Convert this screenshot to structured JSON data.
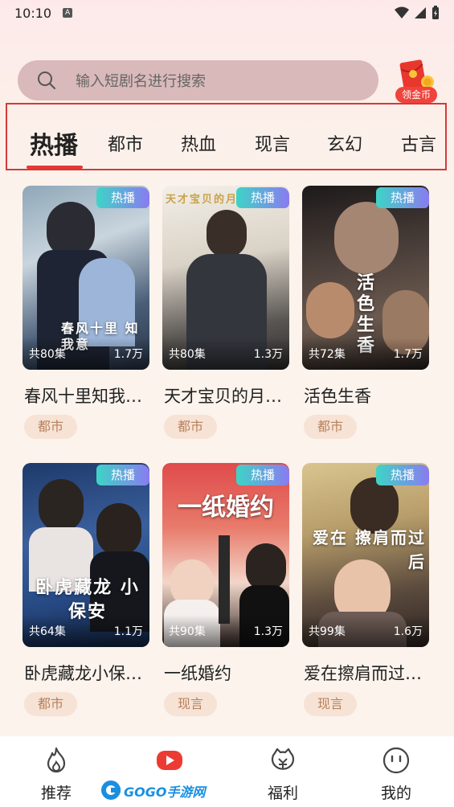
{
  "status": {
    "time": "10:10",
    "a_badge": "A"
  },
  "search": {
    "placeholder": "输入短剧名进行搜索"
  },
  "coin_button": {
    "label": "领金币"
  },
  "tabs": [
    "热播",
    "都市",
    "热血",
    "现言",
    "玄幻",
    "古言"
  ],
  "cards": [
    {
      "badge": "热播",
      "episodes": "共80集",
      "views": "1.7万",
      "title": "春风十里知我…",
      "tag": "都市",
      "art_text": "春风十里 知我意"
    },
    {
      "badge": "热播",
      "episodes": "共80集",
      "views": "1.3万",
      "title": "天才宝贝的月…",
      "tag": "都市",
      "art_text": "天才宝贝的月"
    },
    {
      "badge": "热播",
      "episodes": "共72集",
      "views": "1.7万",
      "title": "活色生香",
      "tag": "都市",
      "art_text": "活色生香"
    },
    {
      "badge": "热播",
      "episodes": "共64集",
      "views": "1.1万",
      "title": "卧虎藏龙小保…",
      "tag": "都市",
      "art_text": "卧虎藏龙 小保安"
    },
    {
      "badge": "热播",
      "episodes": "共90集",
      "views": "1.3万",
      "title": "一纸婚约",
      "tag": "现言",
      "art_text": "一纸婚约"
    },
    {
      "badge": "热播",
      "episodes": "共99集",
      "views": "1.6万",
      "title": "爱在擦肩而过…",
      "tag": "现言",
      "art_text": "爱在 擦肩而过后"
    }
  ],
  "bottom_nav": [
    {
      "label": "推荐",
      "icon": "flame-icon"
    },
    {
      "label": "剧场",
      "icon": "play-icon"
    },
    {
      "label": "福利",
      "icon": "gift-pig-icon"
    },
    {
      "label": "我的",
      "icon": "smiley-icon"
    }
  ],
  "watermark": {
    "text": "GOGO手游网"
  },
  "colors": {
    "accent": "#e53a34",
    "badge_start": "#3ed4c6",
    "badge_end": "#8a7bf0",
    "tag_bg": "#f6e3d6",
    "tag_text": "#b8805a"
  }
}
